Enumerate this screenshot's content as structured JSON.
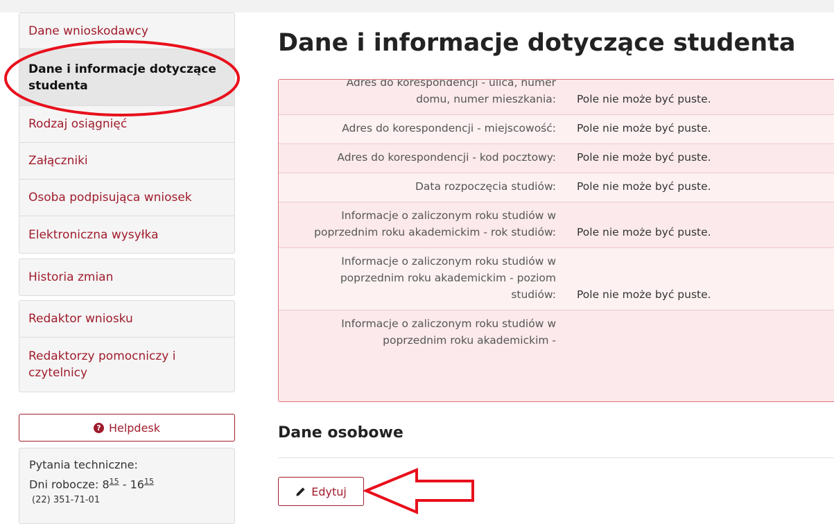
{
  "sidebar": {
    "group1": [
      {
        "label": "Dane wnioskodawcy"
      },
      {
        "label": "Dane i informacje dotyczące studenta",
        "active": true
      },
      {
        "label": "Rodzaj osiągnięć"
      },
      {
        "label": "Załączniki"
      },
      {
        "label": "Osoba podpisująca wniosek"
      },
      {
        "label": "Elektroniczna wysyłka"
      }
    ],
    "group2": [
      {
        "label": "Historia zmian"
      }
    ],
    "group3": [
      {
        "label": "Redaktor wniosku"
      },
      {
        "label": "Redaktorzy pomocniczy i czytelnicy"
      }
    ]
  },
  "helpdesk": {
    "button_label": "Helpdesk",
    "icon": "question-circle-icon",
    "tech_title": "Pytania techniczne:",
    "days_label": "Dni robocze: 8",
    "hour_from_sup": "15",
    "dash": " - 16",
    "hour_to_sup": "15",
    "phone": "(22) 351-71-01"
  },
  "main": {
    "title": "Dane i informacje dotyczące studenta",
    "errors": [
      {
        "label": "Adres do korespondencji - ulica, numer domu, numer mieszkania:",
        "msg": "Pole nie może być puste."
      },
      {
        "label": "Adres do korespondencji - miejscowość:",
        "msg": "Pole nie może być puste."
      },
      {
        "label": "Adres do korespondencji - kod pocztowy:",
        "msg": "Pole nie może być puste."
      },
      {
        "label": "Data rozpoczęcia studiów:",
        "msg": "Pole nie może być puste."
      },
      {
        "label": "Informacje o zaliczonym roku studiów w poprzednim roku akademickim - rok studiów:",
        "msg": "Pole nie może być puste."
      },
      {
        "label": "Informacje o zaliczonym roku studiów w poprzednim roku akademickim - poziom studiów:",
        "msg": "Pole nie może być puste."
      },
      {
        "label": "Informacje o zaliczonym roku studiów w poprzednim roku akademickim - ",
        "msg": ""
      }
    ],
    "section_title": "Dane osobowe",
    "edit_label": "Edytuj",
    "edit_icon": "pencil-icon"
  },
  "colors": {
    "brand": "#a01c2c",
    "error_bg": "#fbe9eb",
    "annotation": "#e8101c"
  }
}
